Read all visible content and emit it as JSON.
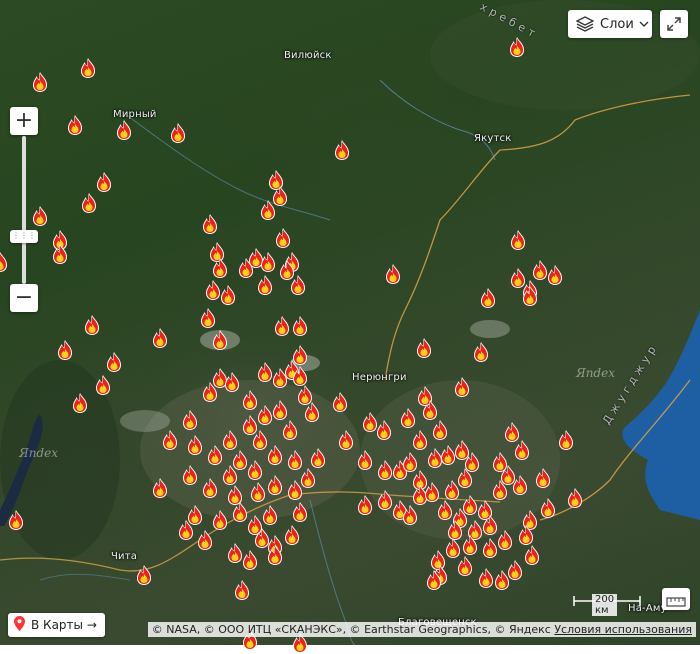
{
  "map": {
    "layers_label": "Слои",
    "to_maps_label": "В Карты →",
    "scale_label": "200 км",
    "attribution": "© NASA, © ООО ИТЦ «СКАНЭКС», © Earthstar Geographics, © Яндекс",
    "terms_label": "Условия использования",
    "watermark": "Яndex",
    "zoom_in_label": "+",
    "zoom_out_label": "−",
    "icons": {
      "fire": "fire-icon",
      "layers": "layers-icon",
      "fullscreen": "expand-icon",
      "location": "location-pin-icon",
      "ruler": "ruler-icon"
    },
    "colors": {
      "fire_outer": "#e8231c",
      "fire_inner": "#ffd11a",
      "river": "#6aa8d8",
      "border": "#d8a24a",
      "sea": "#1e5fa3"
    }
  },
  "places": [
    {
      "name": "Вилюйск"
    },
    {
      "name": "Мирный"
    },
    {
      "name": "Якутск"
    },
    {
      "name": "Нерюнгри"
    },
    {
      "name": "Чита"
    },
    {
      "name": "Благовещенск"
    },
    {
      "name": "На-Аму"
    }
  ],
  "region_labels": [
    {
      "text": "Джугджур"
    },
    {
      "text": "хребет"
    }
  ]
}
